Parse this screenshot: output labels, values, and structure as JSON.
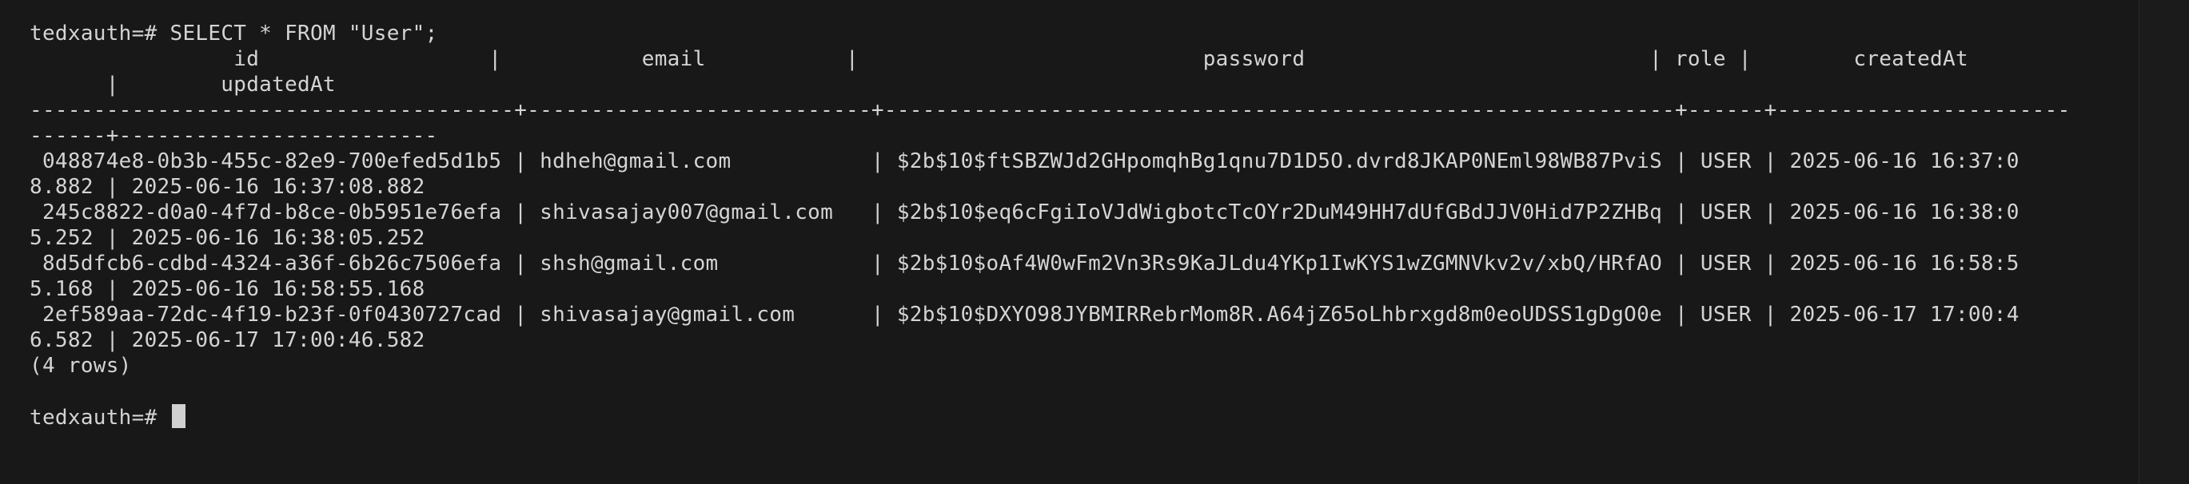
{
  "terminal": {
    "prompt": "tedxauth=# ",
    "command": "SELECT * FROM \"User\";",
    "header_line_1": "                id                  |           email           |                           password                           | role |        createdAt",
    "header_line_2": "      |        updatedAt",
    "separator_line_1": "--------------------------------------+---------------------------+--------------------------------------------------------------+------+-----------------------",
    "separator_line_2": "------+-------------------------",
    "rows": [
      {
        "line_1": " 048874e8-0b3b-455c-82e9-700efed5d1b5 | hdheh@gmail.com           | $2b$10$ftSBZWJd2GHpomqhBg1qnu7D1D5O.dvrd8JKAP0NEml98WB87PviS | USER | 2025-06-16 16:37:0",
        "line_2": "8.882 | 2025-06-16 16:37:08.882"
      },
      {
        "line_1": " 245c8822-d0a0-4f7d-b8ce-0b5951e76efa | shivasajay007@gmail.com   | $2b$10$eq6cFgiIoVJdWigbotcTcOYr2DuM49HH7dUfGBdJJV0Hid7P2ZHBq | USER | 2025-06-16 16:38:0",
        "line_2": "5.252 | 2025-06-16 16:38:05.252"
      },
      {
        "line_1": " 8d5dfcb6-cdbd-4324-a36f-6b26c7506efa | shsh@gmail.com            | $2b$10$oAf4W0wFm2Vn3Rs9KaJLdu4YKp1IwKYS1wZGMNVkv2v/xbQ/HRfAO | USER | 2025-06-16 16:58:5",
        "line_2": "5.168 | 2025-06-16 16:58:55.168"
      },
      {
        "line_1": " 2ef589aa-72dc-4f19-b23f-0f0430727cad | shivasajay@gmail.com      | $2b$10$DXYO98JYBMIRRebrMom8R.A64jZ65oLhbrxgd8m0eoUDSS1gDgO0e | USER | 2025-06-17 17:00:4",
        "line_2": "6.582 | 2025-06-17 17:00:46.582"
      }
    ],
    "row_count": "(4 rows)",
    "final_prompt": "tedxauth=# "
  },
  "colors": {
    "background": "#181818",
    "text": "#d4d4d4",
    "cursor": "#d0d0d0"
  }
}
